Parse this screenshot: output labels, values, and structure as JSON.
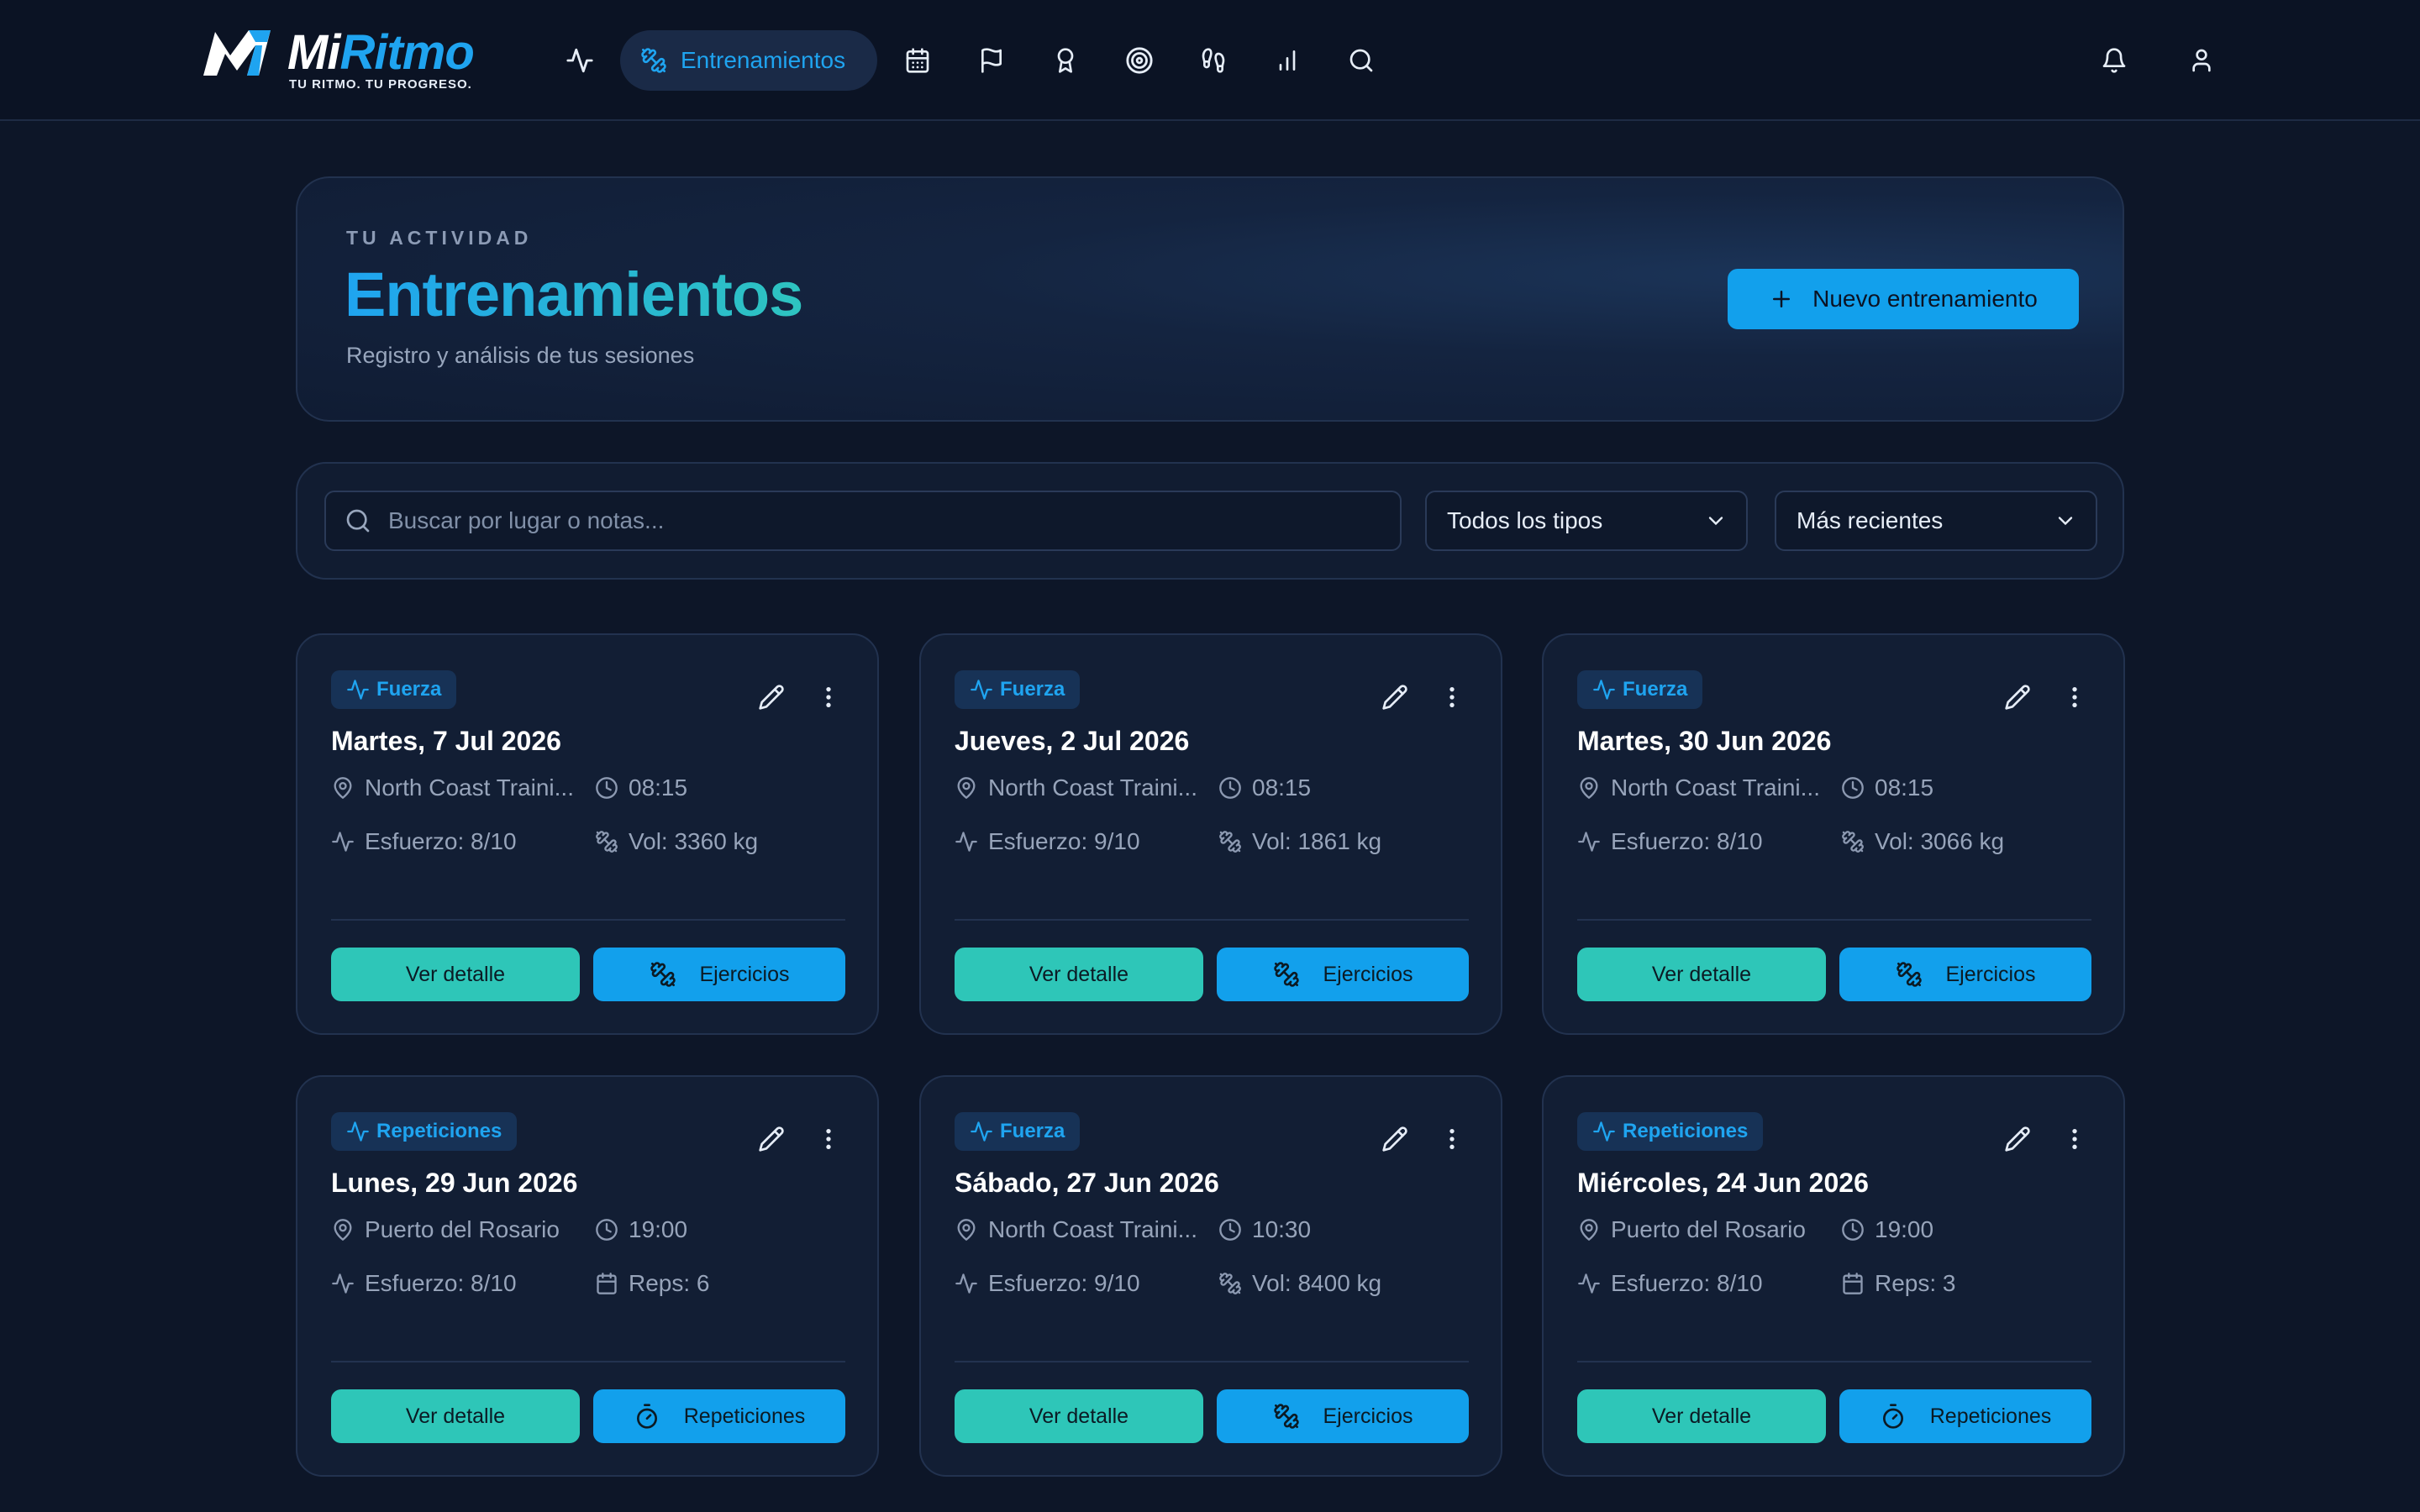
{
  "brand": {
    "name_part1": "Mi",
    "name_part2": "Ritmo",
    "tagline": "TU RITMO. TU PROGRESO."
  },
  "nav": {
    "items": [
      {
        "name": "nav-activity",
        "icon": "activity-icon"
      },
      {
        "name": "nav-workouts",
        "icon": "dumbbell-icon",
        "label": "Entrenamientos",
        "active": true
      },
      {
        "name": "nav-calendar",
        "icon": "calendar-icon"
      },
      {
        "name": "nav-goals",
        "icon": "flag-icon"
      },
      {
        "name": "nav-achievements",
        "icon": "award-icon"
      },
      {
        "name": "nav-targets",
        "icon": "target-icon"
      },
      {
        "name": "nav-steps",
        "icon": "footprints-icon"
      },
      {
        "name": "nav-stats",
        "icon": "bar-chart-icon"
      },
      {
        "name": "nav-search",
        "icon": "search-icon"
      }
    ],
    "right": [
      {
        "name": "notifications",
        "icon": "bell-icon"
      },
      {
        "name": "profile",
        "icon": "user-icon"
      }
    ]
  },
  "hero": {
    "eyebrow": "TU ACTIVIDAD",
    "title": "Entrenamientos",
    "subtitle": "Registro y análisis de tus sesiones",
    "new_button": "Nuevo entrenamiento"
  },
  "filters": {
    "search_placeholder": "Buscar por lugar o notas...",
    "type_selected": "Todos los tipos",
    "sort_selected": "Más recientes"
  },
  "cards": [
    {
      "type": "Fuerza",
      "date": "Martes, 7 Jul 2026",
      "place": "North Coast Traini...",
      "time": "08:15",
      "effort": "Esfuerzo: 8/10",
      "metric": "Vol: 3360 kg",
      "metric_icon": "dumbbell-icon",
      "detail": "Ver detalle",
      "second": "Ejercicios",
      "second_icon": "dumbbell-icon"
    },
    {
      "type": "Fuerza",
      "date": "Jueves, 2 Jul 2026",
      "place": "North Coast Traini...",
      "time": "08:15",
      "effort": "Esfuerzo: 9/10",
      "metric": "Vol: 1861 kg",
      "metric_icon": "dumbbell-icon",
      "detail": "Ver detalle",
      "second": "Ejercicios",
      "second_icon": "dumbbell-icon"
    },
    {
      "type": "Fuerza",
      "date": "Martes, 30 Jun 2026",
      "place": "North Coast Traini...",
      "time": "08:15",
      "effort": "Esfuerzo: 8/10",
      "metric": "Vol: 3066 kg",
      "metric_icon": "dumbbell-icon",
      "detail": "Ver detalle",
      "second": "Ejercicios",
      "second_icon": "dumbbell-icon"
    },
    {
      "type": "Repeticiones",
      "date": "Lunes, 29 Jun 2026",
      "place": "Puerto del Rosario",
      "time": "19:00",
      "effort": "Esfuerzo: 8/10",
      "metric": "Reps: 6",
      "metric_icon": "calendar-icon",
      "detail": "Ver detalle",
      "second": "Repeticiones",
      "second_icon": "timer-icon"
    },
    {
      "type": "Fuerza",
      "date": "Sábado, 27 Jun 2026",
      "place": "North Coast Traini...",
      "time": "10:30",
      "effort": "Esfuerzo: 9/10",
      "metric": "Vol: 8400 kg",
      "metric_icon": "dumbbell-icon",
      "detail": "Ver detalle",
      "second": "Ejercicios",
      "second_icon": "dumbbell-icon"
    },
    {
      "type": "Repeticiones",
      "date": "Miércoles, 24 Jun 2026",
      "place": "Puerto del Rosario",
      "time": "19:00",
      "effort": "Esfuerzo: 8/10",
      "metric": "Reps: 3",
      "metric_icon": "calendar-icon",
      "detail": "Ver detalle",
      "second": "Repeticiones",
      "second_icon": "timer-icon"
    }
  ],
  "colors": {
    "background": "#0d1628",
    "accent_blue": "#12a0ec",
    "accent_teal": "#2ec6b8",
    "card": "#121e34"
  }
}
